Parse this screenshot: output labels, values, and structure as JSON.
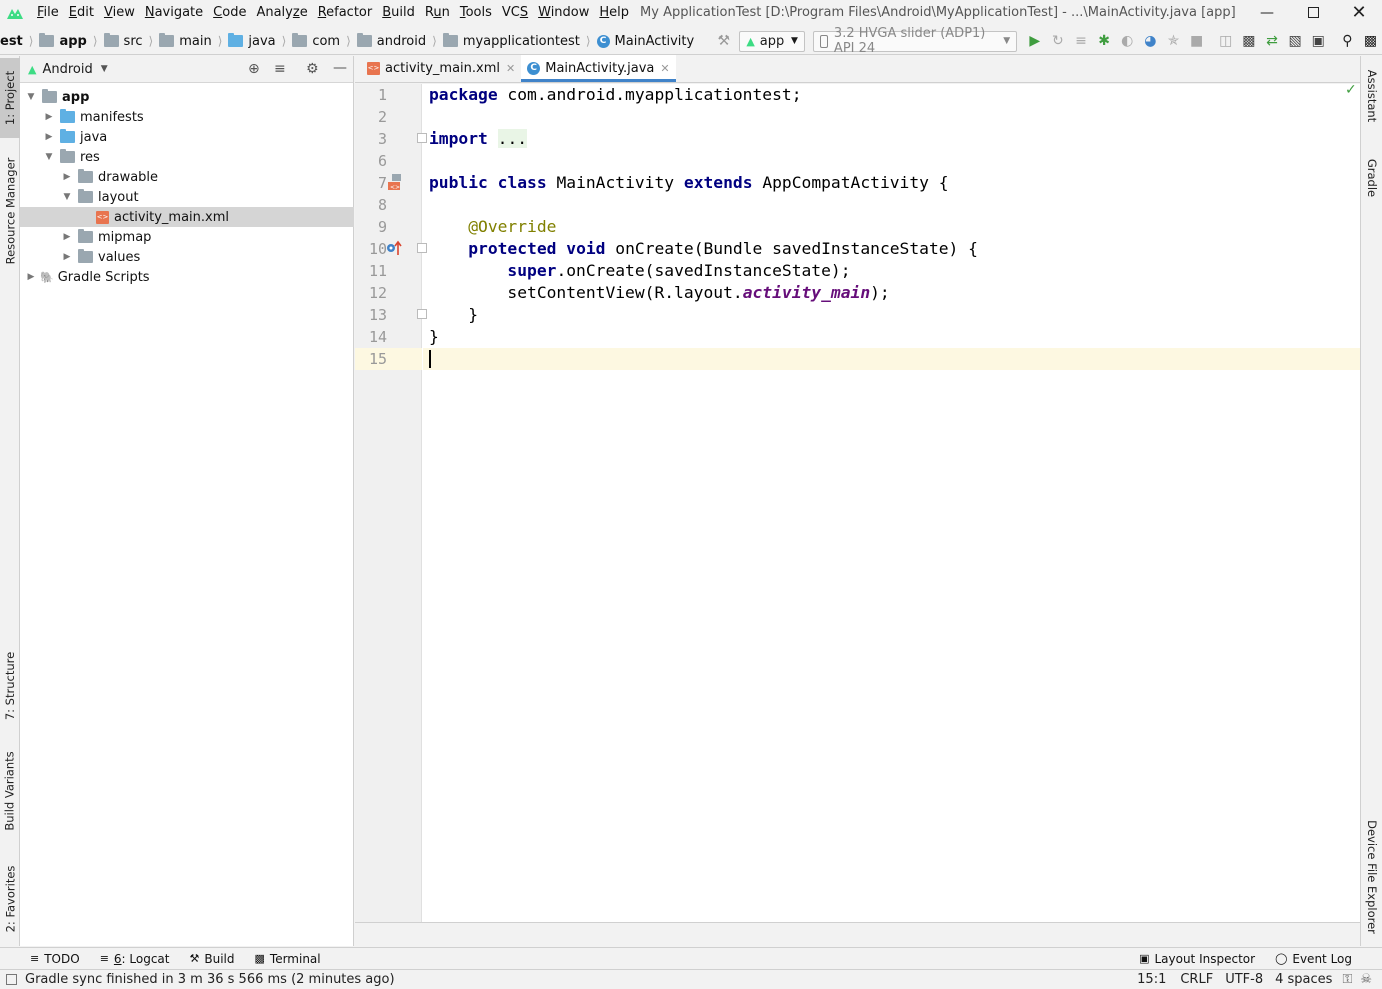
{
  "menu": {
    "items": [
      {
        "pre": "",
        "ul": "F",
        "post": "ile"
      },
      {
        "pre": "",
        "ul": "E",
        "post": "dit"
      },
      {
        "pre": "",
        "ul": "V",
        "post": "iew"
      },
      {
        "pre": "",
        "ul": "N",
        "post": "avigate"
      },
      {
        "pre": "",
        "ul": "C",
        "post": "ode"
      },
      {
        "pre": "Analy",
        "ul": "z",
        "post": "e"
      },
      {
        "pre": "",
        "ul": "R",
        "post": "efactor"
      },
      {
        "pre": "",
        "ul": "B",
        "post": "uild"
      },
      {
        "pre": "R",
        "ul": "u",
        "post": "n"
      },
      {
        "pre": "",
        "ul": "T",
        "post": "ools"
      },
      {
        "pre": "VC",
        "ul": "S",
        "post": ""
      },
      {
        "pre": "",
        "ul": "W",
        "post": "indow"
      },
      {
        "pre": "",
        "ul": "H",
        "post": "elp"
      }
    ],
    "window_title": "My ApplicationTest [D:\\Program Files\\Android\\MyApplicationTest] - ...\\MainActivity.java [app]"
  },
  "breadcrumb": {
    "items": [
      "est",
      "app",
      "src",
      "main",
      "java",
      "com",
      "android",
      "myapplicationtest",
      "MainActivity"
    ]
  },
  "toolbar": {
    "run_config": "app",
    "device": "3.2  HVGA slider (ADP1) API 24"
  },
  "left_strip": {
    "project": "1: Project",
    "resource_manager": "Resource Manager",
    "structure": "7: Structure",
    "build_variants": "Build Variants",
    "favorites": "2: Favorites"
  },
  "right_strip": {
    "assistant": "Assistant",
    "gradle": "Gradle",
    "device_file_explorer": "Device File Explorer"
  },
  "project_panel": {
    "view_mode": "Android",
    "tree": [
      {
        "label": "app",
        "level": 0,
        "expanded": true,
        "icon": "module-folder",
        "bold": true
      },
      {
        "label": "manifests",
        "level": 1,
        "expanded": false,
        "icon": "blue-folder"
      },
      {
        "label": "java",
        "level": 1,
        "expanded": false,
        "icon": "blue-folder"
      },
      {
        "label": "res",
        "level": 1,
        "expanded": true,
        "icon": "res-folder"
      },
      {
        "label": "drawable",
        "level": 2,
        "expanded": false,
        "icon": "folder"
      },
      {
        "label": "layout",
        "level": 2,
        "expanded": true,
        "icon": "folder"
      },
      {
        "label": "activity_main.xml",
        "level": 3,
        "icon": "xml-file",
        "selected": true
      },
      {
        "label": "mipmap",
        "level": 2,
        "expanded": false,
        "icon": "folder"
      },
      {
        "label": "values",
        "level": 2,
        "expanded": false,
        "icon": "folder"
      },
      {
        "label": "Gradle Scripts",
        "level": 0,
        "expanded": false,
        "icon": "gradle"
      }
    ]
  },
  "editor": {
    "tabs": [
      {
        "label": "activity_main.xml",
        "active": false
      },
      {
        "label": "MainActivity.java",
        "active": true
      }
    ],
    "line_numbers": [
      "1",
      "2",
      "3",
      "6",
      "7",
      "8",
      "9",
      "10",
      "11",
      "12",
      "13",
      "14",
      "15"
    ],
    "code": {
      "l1_kw": "package",
      "l1_rest": " com.android.myapplicationtest;",
      "l3_kw": "import",
      "l3_fold": "...",
      "l7_kw1": "public",
      "l7_kw2": "class",
      "l7_mid": " MainActivity ",
      "l7_kw3": "extends",
      "l7_rest": " AppCompatActivity {",
      "l9_ann": "@Override",
      "l10_kw1": "protected",
      "l10_kw2": "void",
      "l10_rest": " onCreate(Bundle savedInstanceState) {",
      "l11_kw": "super",
      "l11_rest": ".onCreate(savedInstanceState);",
      "l12_pre": "setContentView(R.layout.",
      "l12_ital": "activity_main",
      "l12_post": ");",
      "l13": "}",
      "l14": "}"
    }
  },
  "bottom_tabs": {
    "todo": "TODO",
    "logcat_ul": "6",
    "logcat_rest": ": Logcat",
    "build": "Build",
    "terminal": "Terminal",
    "layout_inspector": "Layout Inspector",
    "event_log": "Event Log"
  },
  "status": {
    "message": "Gradle sync finished in 3 m 36 s 566 ms (2 minutes ago)",
    "position": "15:1",
    "line_sep": "CRLF",
    "encoding": "UTF-8",
    "indent": "4 spaces"
  },
  "colors": {
    "accent": "#4083c9",
    "keyword": "#000080",
    "annotation": "#808000",
    "android_green": "#3ddc84"
  }
}
